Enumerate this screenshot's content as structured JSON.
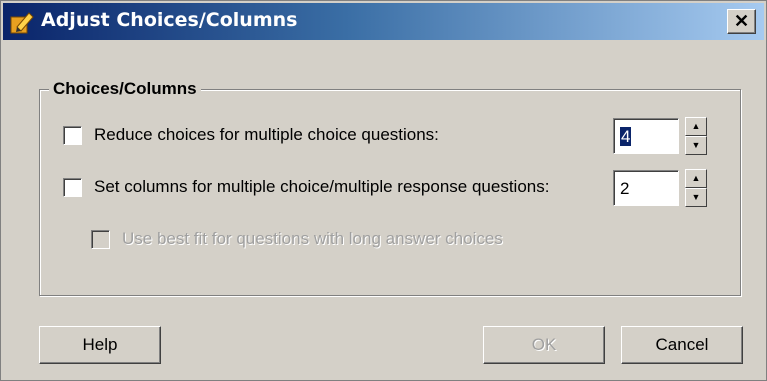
{
  "window": {
    "title": "Adjust Choices/Columns",
    "close_glyph": "✕"
  },
  "group": {
    "label": "Choices/Columns"
  },
  "options": [
    {
      "label": "Reduce choices for multiple choice questions:",
      "checked": false,
      "spin_value": "4"
    },
    {
      "label": "Set columns for multiple choice/multiple response questions:",
      "checked": false,
      "spin_value": "2"
    },
    {
      "label": "Use best fit for questions with long answer choices",
      "checked": false,
      "enabled": false
    }
  ],
  "buttons": {
    "help": "Help",
    "ok": "OK",
    "cancel": "Cancel"
  },
  "icons": {
    "title": "app-pencil-icon",
    "spin_up": "up-arrow-icon",
    "spin_down": "down-arrow-icon"
  },
  "colors": {
    "titlebar_start": "#0a246a",
    "titlebar_end": "#a6caf0",
    "face": "#d4d0c8"
  }
}
